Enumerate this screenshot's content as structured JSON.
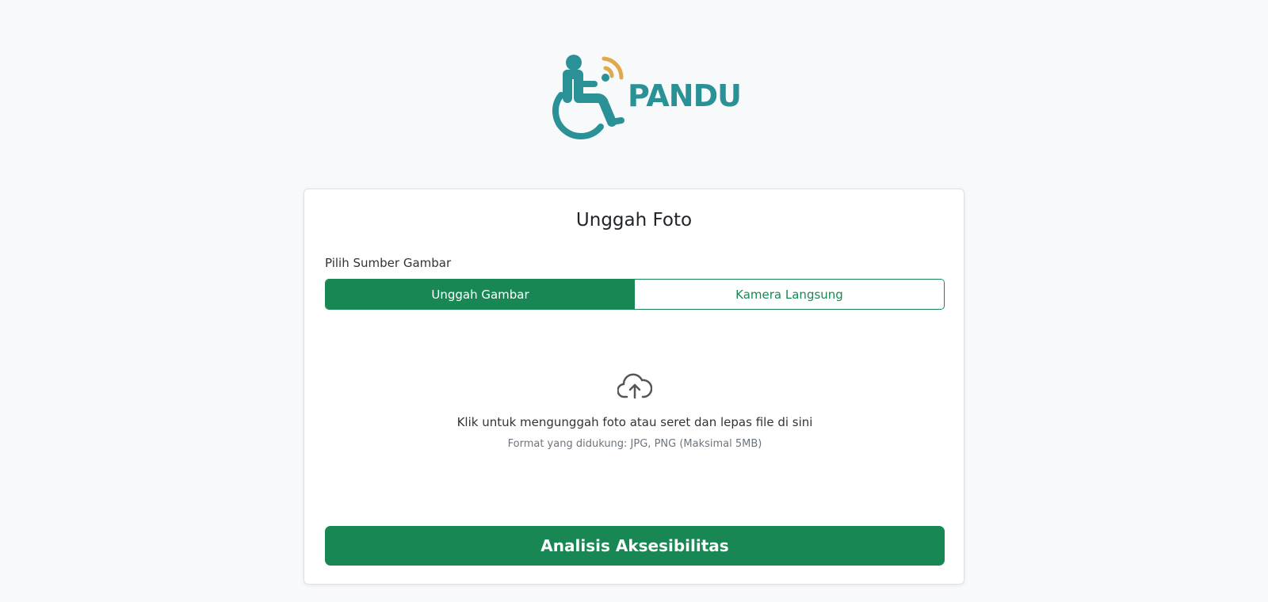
{
  "brand": {
    "name": "PANDU",
    "color": "#2a9296",
    "accent": "#e0a94a"
  },
  "card": {
    "title": "Unggah Foto",
    "source_label": "Pilih Sumber Gambar",
    "toggle": {
      "upload_label": "Unggah Gambar",
      "camera_label": "Kamera Langsung",
      "selected": "Unggah Gambar"
    },
    "dropzone": {
      "icon": "cloud-upload-icon",
      "main_text": "Klik untuk mengunggah foto atau seret dan lepas file di sini",
      "sub_text": "Format yang didukung: JPG, PNG (Maksimal 5MB)"
    },
    "analyze_label": "Analisis Aksesibilitas"
  },
  "colors": {
    "primary": "#198754",
    "background": "#f8f9fb"
  }
}
